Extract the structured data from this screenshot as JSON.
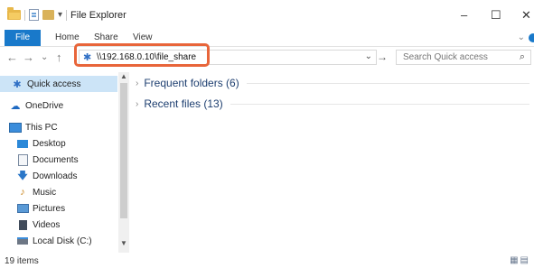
{
  "window": {
    "title": "File Explorer",
    "controls": {
      "minimize": "–",
      "maximize": "☐",
      "close": "✕"
    }
  },
  "quick_access_toolbar": {
    "dropdown": "▾"
  },
  "ribbon": {
    "tabs": [
      "File",
      "Home",
      "Share",
      "View"
    ],
    "expand_chevron": "⌄"
  },
  "address_bar": {
    "path": "\\\\192.168.0.10\\file_share",
    "dropdown": "⌄",
    "go": "→"
  },
  "nav_buttons": {
    "back": "←",
    "forward": "→",
    "recent": "⌄",
    "up": "↑"
  },
  "search": {
    "placeholder": "Search Quick access",
    "icon": "search-icon"
  },
  "navigation_pane": {
    "items": [
      {
        "label": "Quick access",
        "icon": "pin-icon",
        "selected": true
      },
      {
        "label": "OneDrive",
        "icon": "cloud-icon"
      },
      {
        "label": "This PC",
        "icon": "computer-icon"
      },
      {
        "label": "Desktop",
        "icon": "desktop-icon"
      },
      {
        "label": "Documents",
        "icon": "documents-icon"
      },
      {
        "label": "Downloads",
        "icon": "download-icon"
      },
      {
        "label": "Music",
        "icon": "music-icon"
      },
      {
        "label": "Pictures",
        "icon": "pictures-icon"
      },
      {
        "label": "Videos",
        "icon": "videos-icon"
      },
      {
        "label": "Local Disk (C:)",
        "icon": "drive-icon"
      }
    ]
  },
  "content": {
    "groups": [
      {
        "label": "Frequent folders (6)",
        "expanded": false
      },
      {
        "label": "Recent files (13)",
        "expanded": false
      }
    ]
  },
  "status_bar": {
    "item_count": "19 items"
  },
  "colors": {
    "accent": "#1979ca",
    "highlight_border": "#e8653a",
    "selection": "#cce4f7"
  }
}
